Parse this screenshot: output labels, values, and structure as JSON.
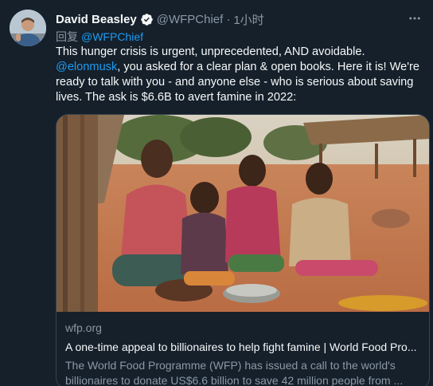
{
  "author": {
    "display_name": "David Beasley",
    "handle": "@WFPChief",
    "separator": "·",
    "timestamp": "1小时",
    "verified_icon": "verified-badge-icon",
    "more_icon": "more-options-icon"
  },
  "reply": {
    "prefix": "回复",
    "mention": "@WFPChief"
  },
  "tweet": {
    "text_part1": "This hunger crisis is urgent, unprecedented, AND avoidable. ",
    "mention": "@elonmusk",
    "text_part2": ", you asked for a clear plan & open books. Here it is! We're ready to talk with you - and anyone else - who is serious about saving lives. The ask is $6.6B to avert famine in 2022:"
  },
  "link_card": {
    "domain": "wfp.org",
    "title": "A one-time appeal to billionaires to help fight famine | World Food Pro...",
    "description": "The World Food Programme (WFP) has issued a call to the world's billionaires to donate US$6.6 billion to save 42 million people from ..."
  },
  "colors": {
    "background": "#15202b",
    "text": "#f7f9f9",
    "secondary": "#8b98a5",
    "link": "#1d9bf0",
    "border": "#38444d"
  }
}
